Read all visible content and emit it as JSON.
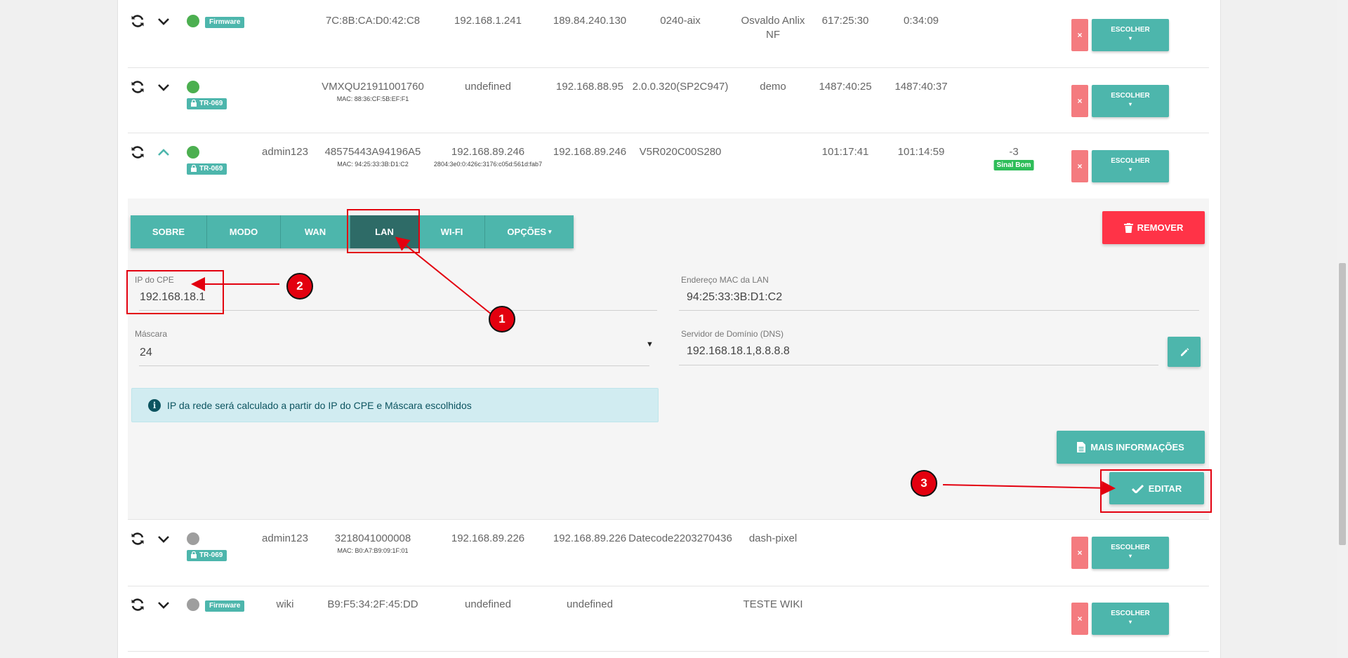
{
  "rows": [
    {
      "status": "green",
      "badge": "Firmware",
      "user": "",
      "serial": "7C:8B:CA:D0:42:C8",
      "mac_sub": "",
      "wan_ip": "192.168.1.241",
      "wan_ip_sub": "",
      "public_ip": "189.84.240.130",
      "version": "0240-aix",
      "name_line1": "Osvaldo Anlix",
      "name_line2": "NF",
      "t1": "617:25:30",
      "t2": "0:34:09",
      "signal": "",
      "signal_badge": "",
      "expanded": false
    },
    {
      "status": "green",
      "badge": "TR-069",
      "user": "",
      "serial": "VMXQU21911001760",
      "mac_sub": "MAC: 88:36:CF:5B:EF:F1",
      "wan_ip": "undefined",
      "wan_ip_sub": "",
      "public_ip": "192.168.88.95",
      "version": "2.0.0.320(SP2C947)",
      "name_line1": "demo",
      "name_line2": "",
      "t1": "1487:40:25",
      "t2": "1487:40:37",
      "signal": "",
      "signal_badge": "",
      "expanded": false
    },
    {
      "status": "green",
      "badge": "TR-069",
      "user": "admin123",
      "serial": "48575443A94196A5",
      "mac_sub": "MAC: 94:25:33:3B:D1:C2",
      "wan_ip": "192.168.89.246",
      "wan_ip_sub": "2804:3e0:0:426c:3176:c05d:561d:fab7",
      "public_ip": "192.168.89.246",
      "version": "V5R020C00S280",
      "name_line1": "",
      "name_line2": "",
      "t1": "101:17:41",
      "t2": "101:14:59",
      "signal": "-3",
      "signal_badge": "Sinal Bom",
      "expanded": true
    },
    {
      "status": "gray",
      "badge": "TR-069",
      "user": "admin123",
      "serial": "3218041000008",
      "mac_sub": "MAC: B0:A7:B9:09:1F:01",
      "wan_ip": "192.168.89.226",
      "wan_ip_sub": "",
      "public_ip": "192.168.89.226",
      "version": "Datecode2203270436",
      "name_line1": "dash-pixel",
      "name_line2": "",
      "t1": "",
      "t2": "",
      "signal": "",
      "signal_badge": "",
      "expanded": false
    },
    {
      "status": "gray",
      "badge": "Firmware",
      "user": "wiki",
      "serial": "B9:F5:34:2F:45:DD",
      "mac_sub": "",
      "wan_ip": "undefined",
      "wan_ip_sub": "",
      "public_ip": "undefined",
      "version": "",
      "name_line1": "TESTE WIKI",
      "name_line2": "",
      "t1": "",
      "t2": "",
      "signal": "",
      "signal_badge": "",
      "expanded": false
    }
  ],
  "row_buttons": {
    "remove_x": "×",
    "choose": "ESCOLHER",
    "caret": "▾"
  },
  "tabs": [
    "SOBRE",
    "MODO",
    "WAN",
    "LAN",
    "WI-FI",
    "OPÇÕES"
  ],
  "active_tab": "LAN",
  "options_caret": "▾",
  "remove_button": "REMOVER",
  "lan": {
    "cpe_ip_label": "IP do CPE",
    "cpe_ip_value": "192.168.18.1",
    "mac_label": "Endereço MAC da LAN",
    "mac_value": "94:25:33:3B:D1:C2",
    "mask_label": "Máscara",
    "mask_value": "24",
    "dns_label": "Servidor de Domínio (DNS)",
    "dns_value": "192.168.18.1,8.8.8.8",
    "info_text": "IP da rede será calculado a partir do IP do CPE e Máscara escolhidos",
    "info_icon": "i"
  },
  "more_info_button": "MAIS INFORMAÇÕES",
  "edit_button": "EDITAR",
  "markers": [
    "1",
    "2",
    "3"
  ],
  "colors": {
    "teal": "#4db6ac",
    "teal_dark": "#2e6b67",
    "red": "#ff3347",
    "annotation": "#e3000f"
  }
}
